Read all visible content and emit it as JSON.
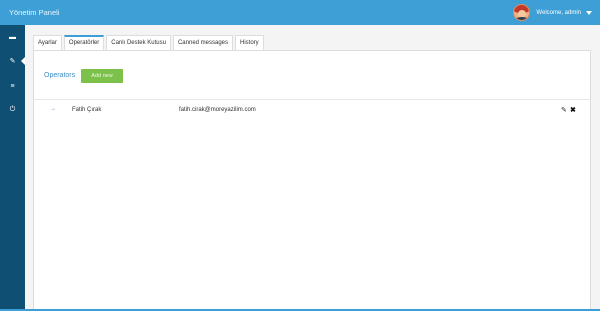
{
  "header": {
    "title": "Yönetim Paneli",
    "welcome": "Welcome, admin"
  },
  "sidebar": {
    "items": [
      {
        "icon": "chat-icon",
        "glyph": "▬"
      },
      {
        "icon": "pencil-icon",
        "glyph": "✎"
      },
      {
        "icon": "list-icon",
        "glyph": "≡"
      },
      {
        "icon": "power-icon",
        "glyph": "⏻"
      }
    ]
  },
  "tabs": [
    {
      "label": "Ayarlar"
    },
    {
      "label": "Operatörler"
    },
    {
      "label": "Canlı Destek Kutusu"
    },
    {
      "label": "Canned messages"
    },
    {
      "label": "History"
    }
  ],
  "panel": {
    "title": "Operators",
    "add_button": "Add new"
  },
  "operators": [
    {
      "arrow": "→",
      "name": "Fatih Çırak",
      "email": "fatih.cirak@moreyazilim.com",
      "edit_glyph": "✎",
      "delete_glyph": "✖"
    }
  ],
  "colors": {
    "topbar": "#3d9fd6",
    "sidebar": "#0f4f74",
    "accent_green": "#7cc14a"
  }
}
